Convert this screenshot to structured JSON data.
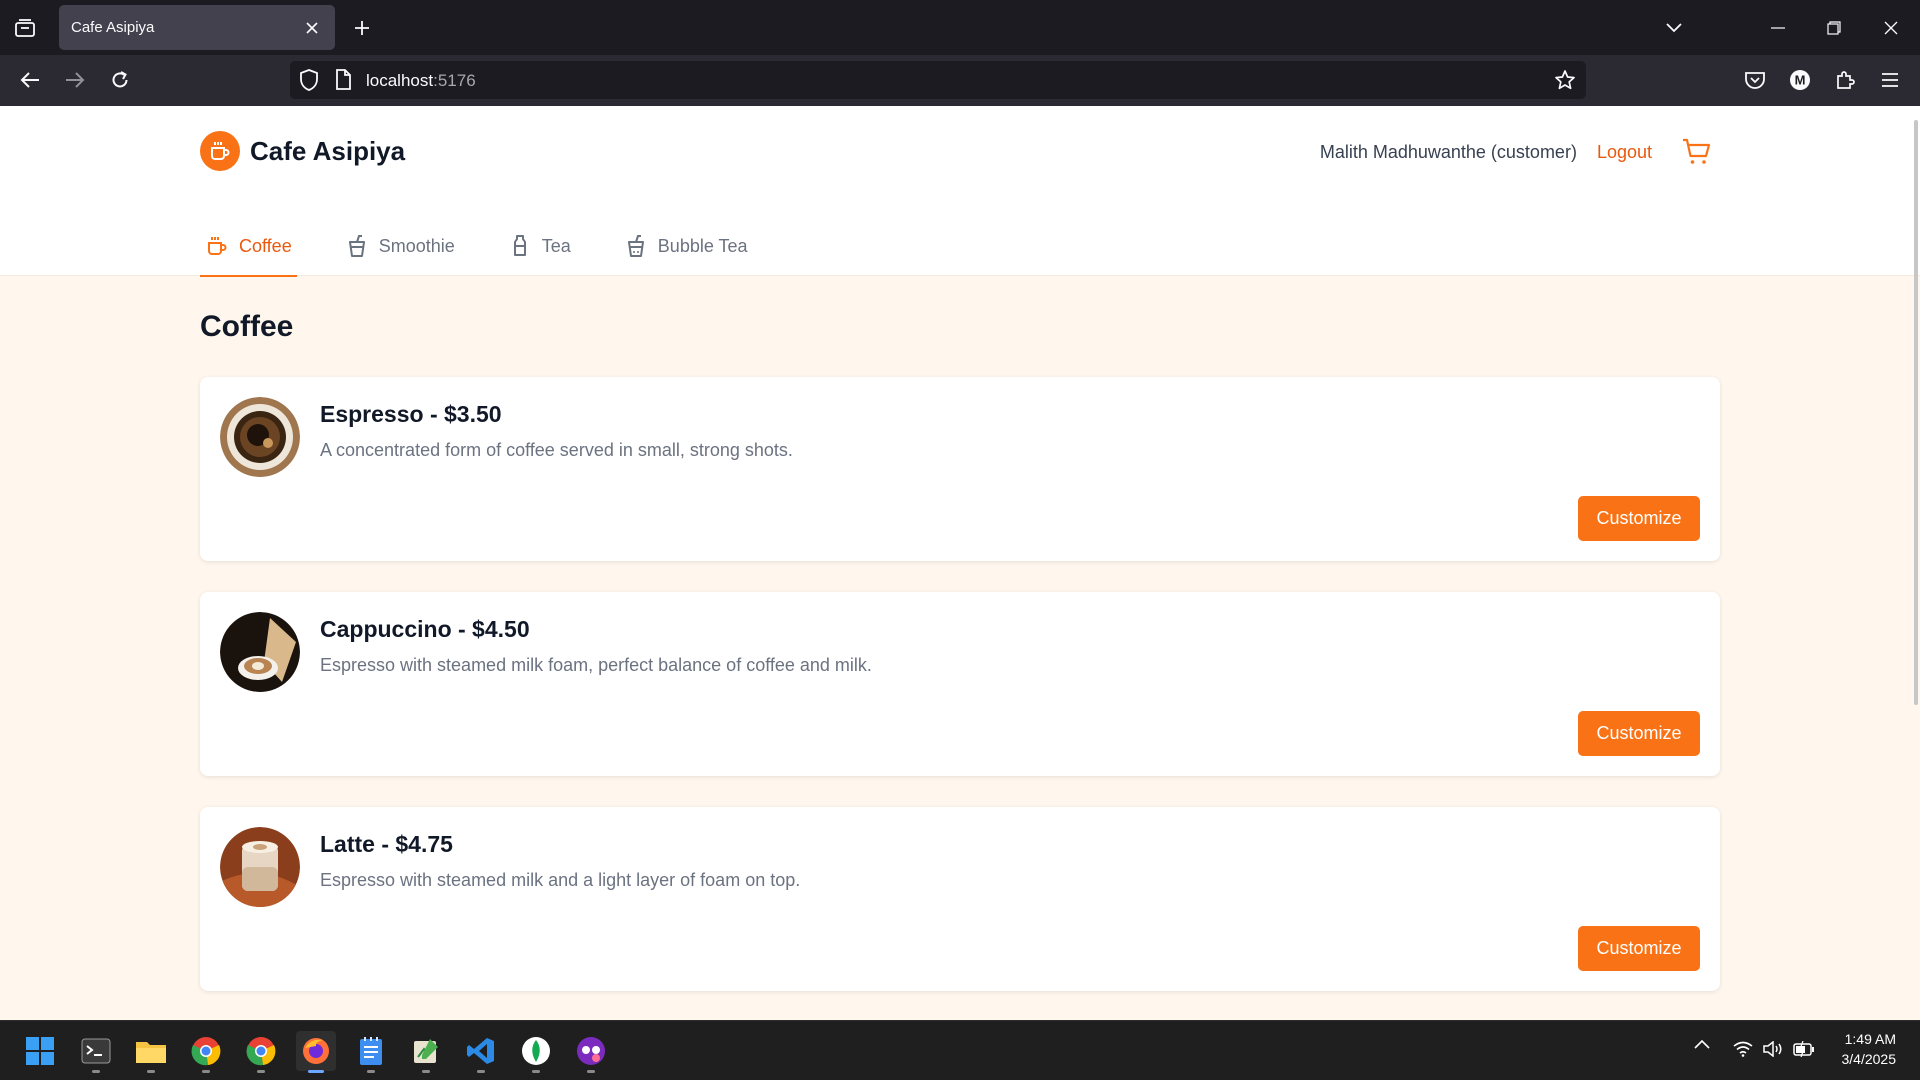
{
  "browser": {
    "tab_title": "Cafe Asipiya",
    "url_host": "localhost",
    "url_port": ":5176"
  },
  "site": {
    "brand": "Cafe Asipiya",
    "user": "Malith Madhuwanthe (customer)",
    "logout": "Logout",
    "accent": "#f97316",
    "categories": [
      {
        "label": "Coffee",
        "icon": "coffee-cup-icon",
        "active": true
      },
      {
        "label": "Smoothie",
        "icon": "smoothie-cup-icon",
        "active": false
      },
      {
        "label": "Tea",
        "icon": "tea-bottle-icon",
        "active": false
      },
      {
        "label": "Bubble Tea",
        "icon": "bubble-tea-cup-icon",
        "active": false
      }
    ],
    "section_title": "Coffee",
    "items": [
      {
        "title": "Espresso - $3.50",
        "desc": "A concentrated form of coffee served in small, strong shots.",
        "button": "Customize"
      },
      {
        "title": "Cappuccino - $4.50",
        "desc": "Espresso with steamed milk foam, perfect balance of coffee and milk.",
        "button": "Customize"
      },
      {
        "title": "Latte - $4.75",
        "desc": "Espresso with steamed milk and a light layer of foam on top.",
        "button": "Customize"
      }
    ]
  },
  "taskbar": {
    "time": "1:49 AM",
    "date": "3/4/2025"
  }
}
